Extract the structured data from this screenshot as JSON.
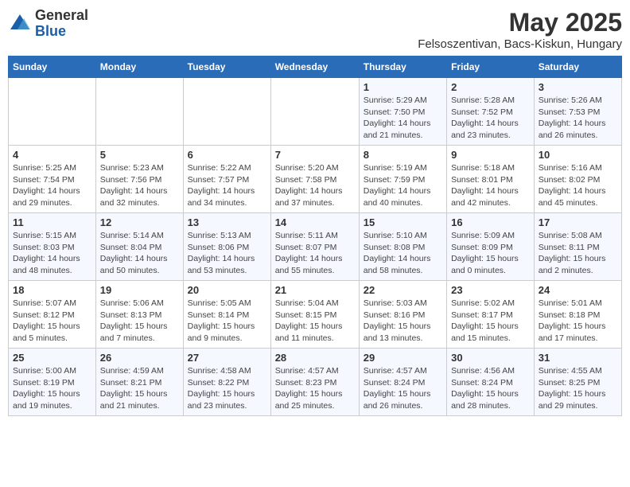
{
  "header": {
    "logo": {
      "general": "General",
      "blue": "Blue"
    },
    "title": "May 2025",
    "subtitle": "Felsoszentivan, Bacs-Kiskun, Hungary"
  },
  "calendar": {
    "days_of_week": [
      "Sunday",
      "Monday",
      "Tuesday",
      "Wednesday",
      "Thursday",
      "Friday",
      "Saturday"
    ],
    "weeks": [
      [
        {
          "day": "",
          "info": ""
        },
        {
          "day": "",
          "info": ""
        },
        {
          "day": "",
          "info": ""
        },
        {
          "day": "",
          "info": ""
        },
        {
          "day": "1",
          "info": "Sunrise: 5:29 AM\nSunset: 7:50 PM\nDaylight: 14 hours and 21 minutes."
        },
        {
          "day": "2",
          "info": "Sunrise: 5:28 AM\nSunset: 7:52 PM\nDaylight: 14 hours and 23 minutes."
        },
        {
          "day": "3",
          "info": "Sunrise: 5:26 AM\nSunset: 7:53 PM\nDaylight: 14 hours and 26 minutes."
        }
      ],
      [
        {
          "day": "4",
          "info": "Sunrise: 5:25 AM\nSunset: 7:54 PM\nDaylight: 14 hours and 29 minutes."
        },
        {
          "day": "5",
          "info": "Sunrise: 5:23 AM\nSunset: 7:56 PM\nDaylight: 14 hours and 32 minutes."
        },
        {
          "day": "6",
          "info": "Sunrise: 5:22 AM\nSunset: 7:57 PM\nDaylight: 14 hours and 34 minutes."
        },
        {
          "day": "7",
          "info": "Sunrise: 5:20 AM\nSunset: 7:58 PM\nDaylight: 14 hours and 37 minutes."
        },
        {
          "day": "8",
          "info": "Sunrise: 5:19 AM\nSunset: 7:59 PM\nDaylight: 14 hours and 40 minutes."
        },
        {
          "day": "9",
          "info": "Sunrise: 5:18 AM\nSunset: 8:01 PM\nDaylight: 14 hours and 42 minutes."
        },
        {
          "day": "10",
          "info": "Sunrise: 5:16 AM\nSunset: 8:02 PM\nDaylight: 14 hours and 45 minutes."
        }
      ],
      [
        {
          "day": "11",
          "info": "Sunrise: 5:15 AM\nSunset: 8:03 PM\nDaylight: 14 hours and 48 minutes."
        },
        {
          "day": "12",
          "info": "Sunrise: 5:14 AM\nSunset: 8:04 PM\nDaylight: 14 hours and 50 minutes."
        },
        {
          "day": "13",
          "info": "Sunrise: 5:13 AM\nSunset: 8:06 PM\nDaylight: 14 hours and 53 minutes."
        },
        {
          "day": "14",
          "info": "Sunrise: 5:11 AM\nSunset: 8:07 PM\nDaylight: 14 hours and 55 minutes."
        },
        {
          "day": "15",
          "info": "Sunrise: 5:10 AM\nSunset: 8:08 PM\nDaylight: 14 hours and 58 minutes."
        },
        {
          "day": "16",
          "info": "Sunrise: 5:09 AM\nSunset: 8:09 PM\nDaylight: 15 hours and 0 minutes."
        },
        {
          "day": "17",
          "info": "Sunrise: 5:08 AM\nSunset: 8:11 PM\nDaylight: 15 hours and 2 minutes."
        }
      ],
      [
        {
          "day": "18",
          "info": "Sunrise: 5:07 AM\nSunset: 8:12 PM\nDaylight: 15 hours and 5 minutes."
        },
        {
          "day": "19",
          "info": "Sunrise: 5:06 AM\nSunset: 8:13 PM\nDaylight: 15 hours and 7 minutes."
        },
        {
          "day": "20",
          "info": "Sunrise: 5:05 AM\nSunset: 8:14 PM\nDaylight: 15 hours and 9 minutes."
        },
        {
          "day": "21",
          "info": "Sunrise: 5:04 AM\nSunset: 8:15 PM\nDaylight: 15 hours and 11 minutes."
        },
        {
          "day": "22",
          "info": "Sunrise: 5:03 AM\nSunset: 8:16 PM\nDaylight: 15 hours and 13 minutes."
        },
        {
          "day": "23",
          "info": "Sunrise: 5:02 AM\nSunset: 8:17 PM\nDaylight: 15 hours and 15 minutes."
        },
        {
          "day": "24",
          "info": "Sunrise: 5:01 AM\nSunset: 8:18 PM\nDaylight: 15 hours and 17 minutes."
        }
      ],
      [
        {
          "day": "25",
          "info": "Sunrise: 5:00 AM\nSunset: 8:19 PM\nDaylight: 15 hours and 19 minutes."
        },
        {
          "day": "26",
          "info": "Sunrise: 4:59 AM\nSunset: 8:21 PM\nDaylight: 15 hours and 21 minutes."
        },
        {
          "day": "27",
          "info": "Sunrise: 4:58 AM\nSunset: 8:22 PM\nDaylight: 15 hours and 23 minutes."
        },
        {
          "day": "28",
          "info": "Sunrise: 4:57 AM\nSunset: 8:23 PM\nDaylight: 15 hours and 25 minutes."
        },
        {
          "day": "29",
          "info": "Sunrise: 4:57 AM\nSunset: 8:24 PM\nDaylight: 15 hours and 26 minutes."
        },
        {
          "day": "30",
          "info": "Sunrise: 4:56 AM\nSunset: 8:24 PM\nDaylight: 15 hours and 28 minutes."
        },
        {
          "day": "31",
          "info": "Sunrise: 4:55 AM\nSunset: 8:25 PM\nDaylight: 15 hours and 29 minutes."
        }
      ]
    ]
  }
}
